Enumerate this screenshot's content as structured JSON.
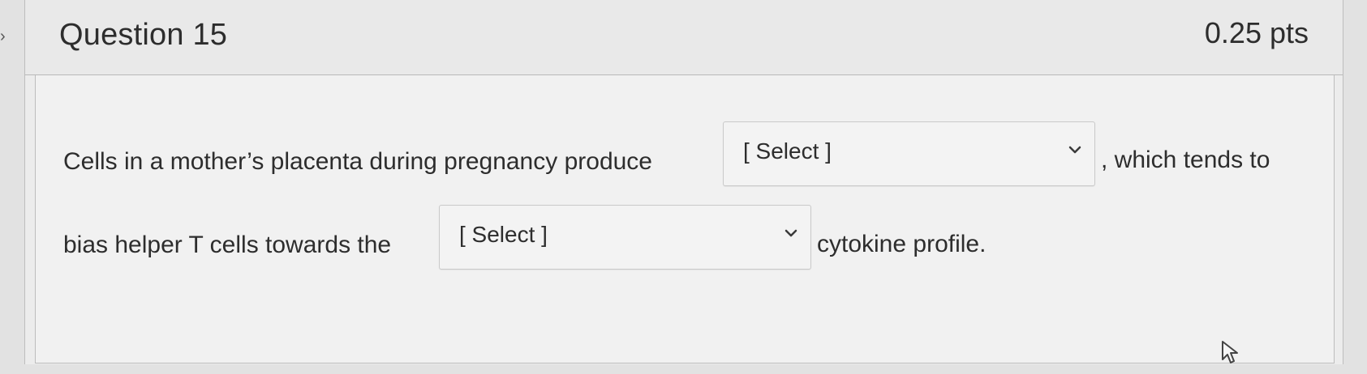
{
  "question": {
    "title": "Question 15",
    "points": "0.25 pts"
  },
  "body": {
    "text_before_select_1": "Cells in a mother’s placenta during pregnancy produce",
    "select_1": {
      "selected": "[ Select ]",
      "icon": "chevron-down-icon"
    },
    "text_after_select_1": ", which tends to",
    "text_before_select_2": "bias helper T cells towards the",
    "select_2": {
      "selected": "[ Select ]",
      "icon": "chevron-down-icon"
    },
    "text_after_select_2": "cytokine profile."
  },
  "icons": {
    "left_nav": "chevron-right-icon",
    "pointer": "mouse-cursor-icon"
  }
}
